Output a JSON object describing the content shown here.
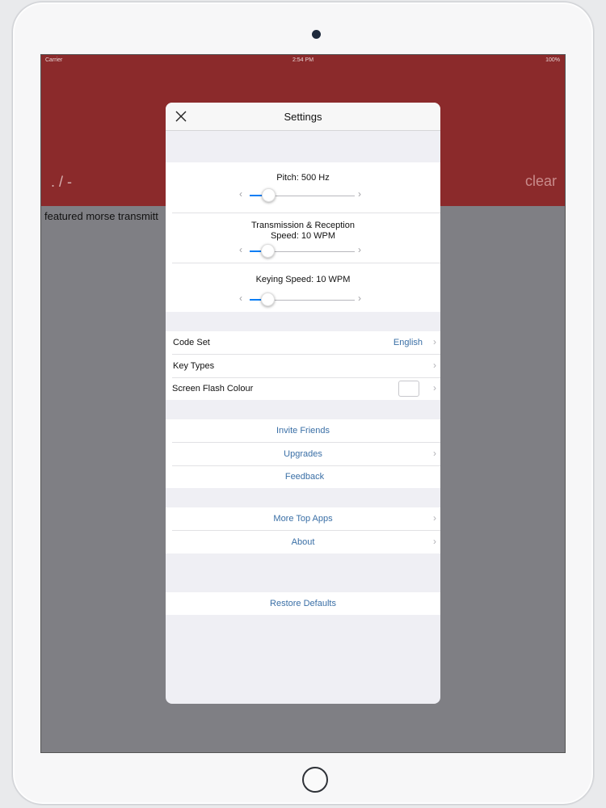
{
  "status": {
    "carrier": "Carrier",
    "time": "2:54 PM",
    "battery": "100%"
  },
  "app": {
    "morse_display": ". / -",
    "clear_label": "clear",
    "transcript": "featured morse transmitt"
  },
  "settings": {
    "title": "Settings",
    "close_icon": "close-icon",
    "sliders": [
      {
        "label": "Pitch: 500 Hz",
        "value": 0.18
      },
      {
        "label": "Transmission & Reception\nSpeed: 10 WPM",
        "value": 0.17
      },
      {
        "label": "Keying Speed: 10 WPM",
        "value": 0.17
      }
    ],
    "rows": {
      "code_set": {
        "label": "Code Set",
        "value": "English"
      },
      "key_types": {
        "label": "Key Types"
      },
      "screen_flash": {
        "label": "Screen Flash Colour"
      }
    },
    "actions": {
      "invite": "Invite Friends",
      "upgrades": "Upgrades",
      "feedback": "Feedback",
      "more_apps": "More Top Apps",
      "about": "About",
      "restore": "Restore Defaults"
    },
    "accent": "#0a7ef5",
    "link_color": "#3a6fa6",
    "header_color": "#8b2a2b"
  }
}
